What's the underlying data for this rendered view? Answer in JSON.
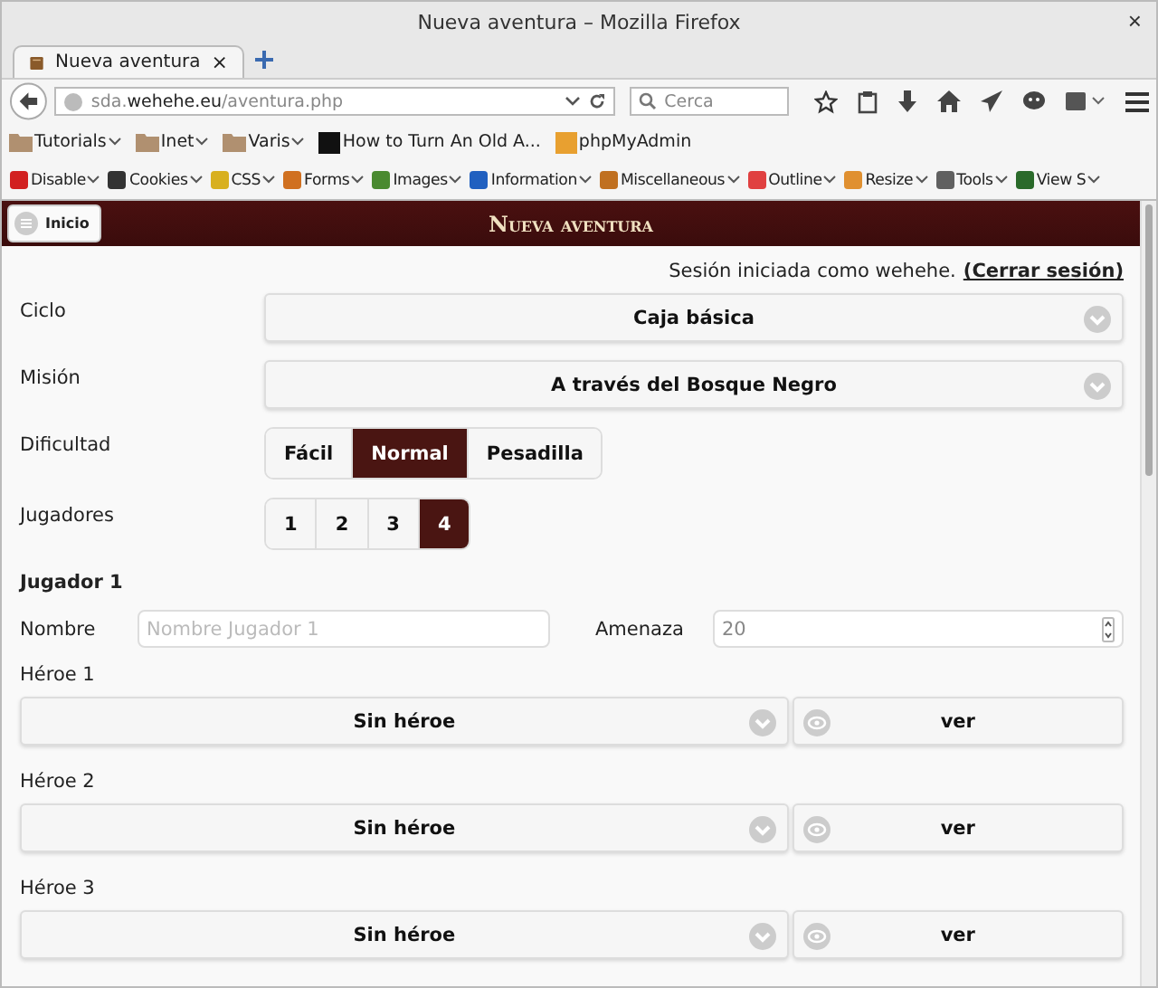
{
  "window": {
    "title": "Nueva aventura – Mozilla Firefox",
    "close": "×"
  },
  "tabs": [
    {
      "label": "Nueva aventura",
      "selected": true,
      "close": "×"
    }
  ],
  "address_bar": {
    "host_prefix": "sda.",
    "host": "wehehe.eu",
    "path": "/aventura.php"
  },
  "search": {
    "placeholder": "Cerca"
  },
  "bookmarks": [
    {
      "label": "Tutorials",
      "kind": "folder"
    },
    {
      "label": "Inet",
      "kind": "folder"
    },
    {
      "label": "Varis",
      "kind": "folder"
    },
    {
      "label": "How to Turn An Old A...",
      "kind": "page"
    },
    {
      "label": "phpMyAdmin",
      "kind": "page"
    }
  ],
  "dev_toolbar": [
    {
      "label": "Disable",
      "color": "#d22020"
    },
    {
      "label": "Cookies",
      "color": "#333333"
    },
    {
      "label": "CSS",
      "color": "#d8b020"
    },
    {
      "label": "Forms",
      "color": "#d07020"
    },
    {
      "label": "Images",
      "color": "#4a8a30"
    },
    {
      "label": "Information",
      "color": "#2060c0"
    },
    {
      "label": "Miscellaneous",
      "color": "#c07020"
    },
    {
      "label": "Outline",
      "color": "#e04040"
    },
    {
      "label": "Resize",
      "color": "#e09030"
    },
    {
      "label": "Tools",
      "color": "#606060"
    },
    {
      "label": "View S",
      "color": "#2a6a2a"
    }
  ],
  "header": {
    "home_button": "Inicio",
    "title": "Nueva aventura"
  },
  "session": {
    "text": "Sesión iniciada como wehehe.",
    "logout": "(Cerrar sesión)"
  },
  "fields": [
    {
      "label": "Ciclo",
      "kind": "select",
      "value": "Caja básica"
    },
    {
      "label": "Misión",
      "kind": "select",
      "value": "A través del Bosque Negro"
    },
    {
      "label": "Dificultad",
      "kind": "segmented",
      "options": [
        {
          "label": "Fácil",
          "selected": false
        },
        {
          "label": "Normal",
          "selected": true
        },
        {
          "label": "Pesadilla",
          "selected": false
        }
      ]
    },
    {
      "label": "Jugadores",
      "kind": "segmented",
      "options": [
        {
          "label": "1",
          "selected": false
        },
        {
          "label": "2",
          "selected": false
        },
        {
          "label": "3",
          "selected": false
        },
        {
          "label": "4",
          "selected": true
        }
      ]
    }
  ],
  "player": {
    "heading": "Jugador 1",
    "name_label": "Nombre",
    "name_placeholder": "Nombre Jugador 1",
    "threat_label": "Amenaza",
    "threat_value": "20",
    "heroes": [
      {
        "label": "Héroe 1",
        "value": "Sin héroe",
        "view": "ver"
      },
      {
        "label": "Héroe 2",
        "value": "Sin héroe",
        "view": "ver"
      },
      {
        "label": "Héroe 3",
        "value": "Sin héroe",
        "view": "ver"
      }
    ]
  }
}
